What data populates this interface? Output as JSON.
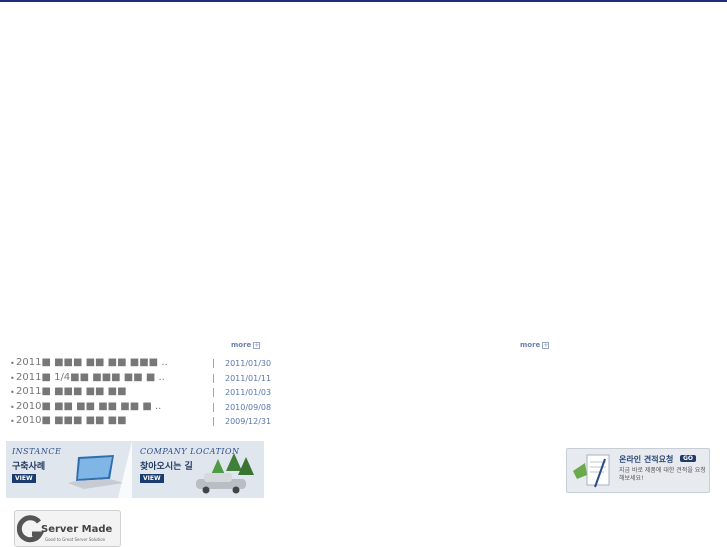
{
  "more_label": "more",
  "news": [
    {
      "title": "2011■ ■■■ ■■ ■■ ■■■ ..",
      "date": "2011/01/30"
    },
    {
      "title": "2011■ 1/4■■ ■■■ ■■ ■ ..",
      "date": "2011/01/11"
    },
    {
      "title": "2011■ ■■■ ■■ ■■",
      "date": "2011/01/03"
    },
    {
      "title": "2010■ ■■ ■■ ■■ ■■ ■ ..",
      "date": "2010/09/08"
    },
    {
      "title": "2010■ ■■■ ■■ ■■",
      "date": "2009/12/31"
    }
  ],
  "banner": {
    "left": {
      "en": "INSTANCE",
      "ko": "구축사례",
      "view": "VIEW"
    },
    "right": {
      "en": "COMPANY LOCATION",
      "ko": "찾아오시는 길",
      "view": "VIEW"
    }
  },
  "quote": {
    "title": "온라인 견적요청",
    "go": "GO",
    "desc": "지금 바로 제품에 대한 견적을 요청해보세요!"
  },
  "logo": {
    "brand": "Server Made",
    "tagline": "Good to Great Server Solution"
  }
}
